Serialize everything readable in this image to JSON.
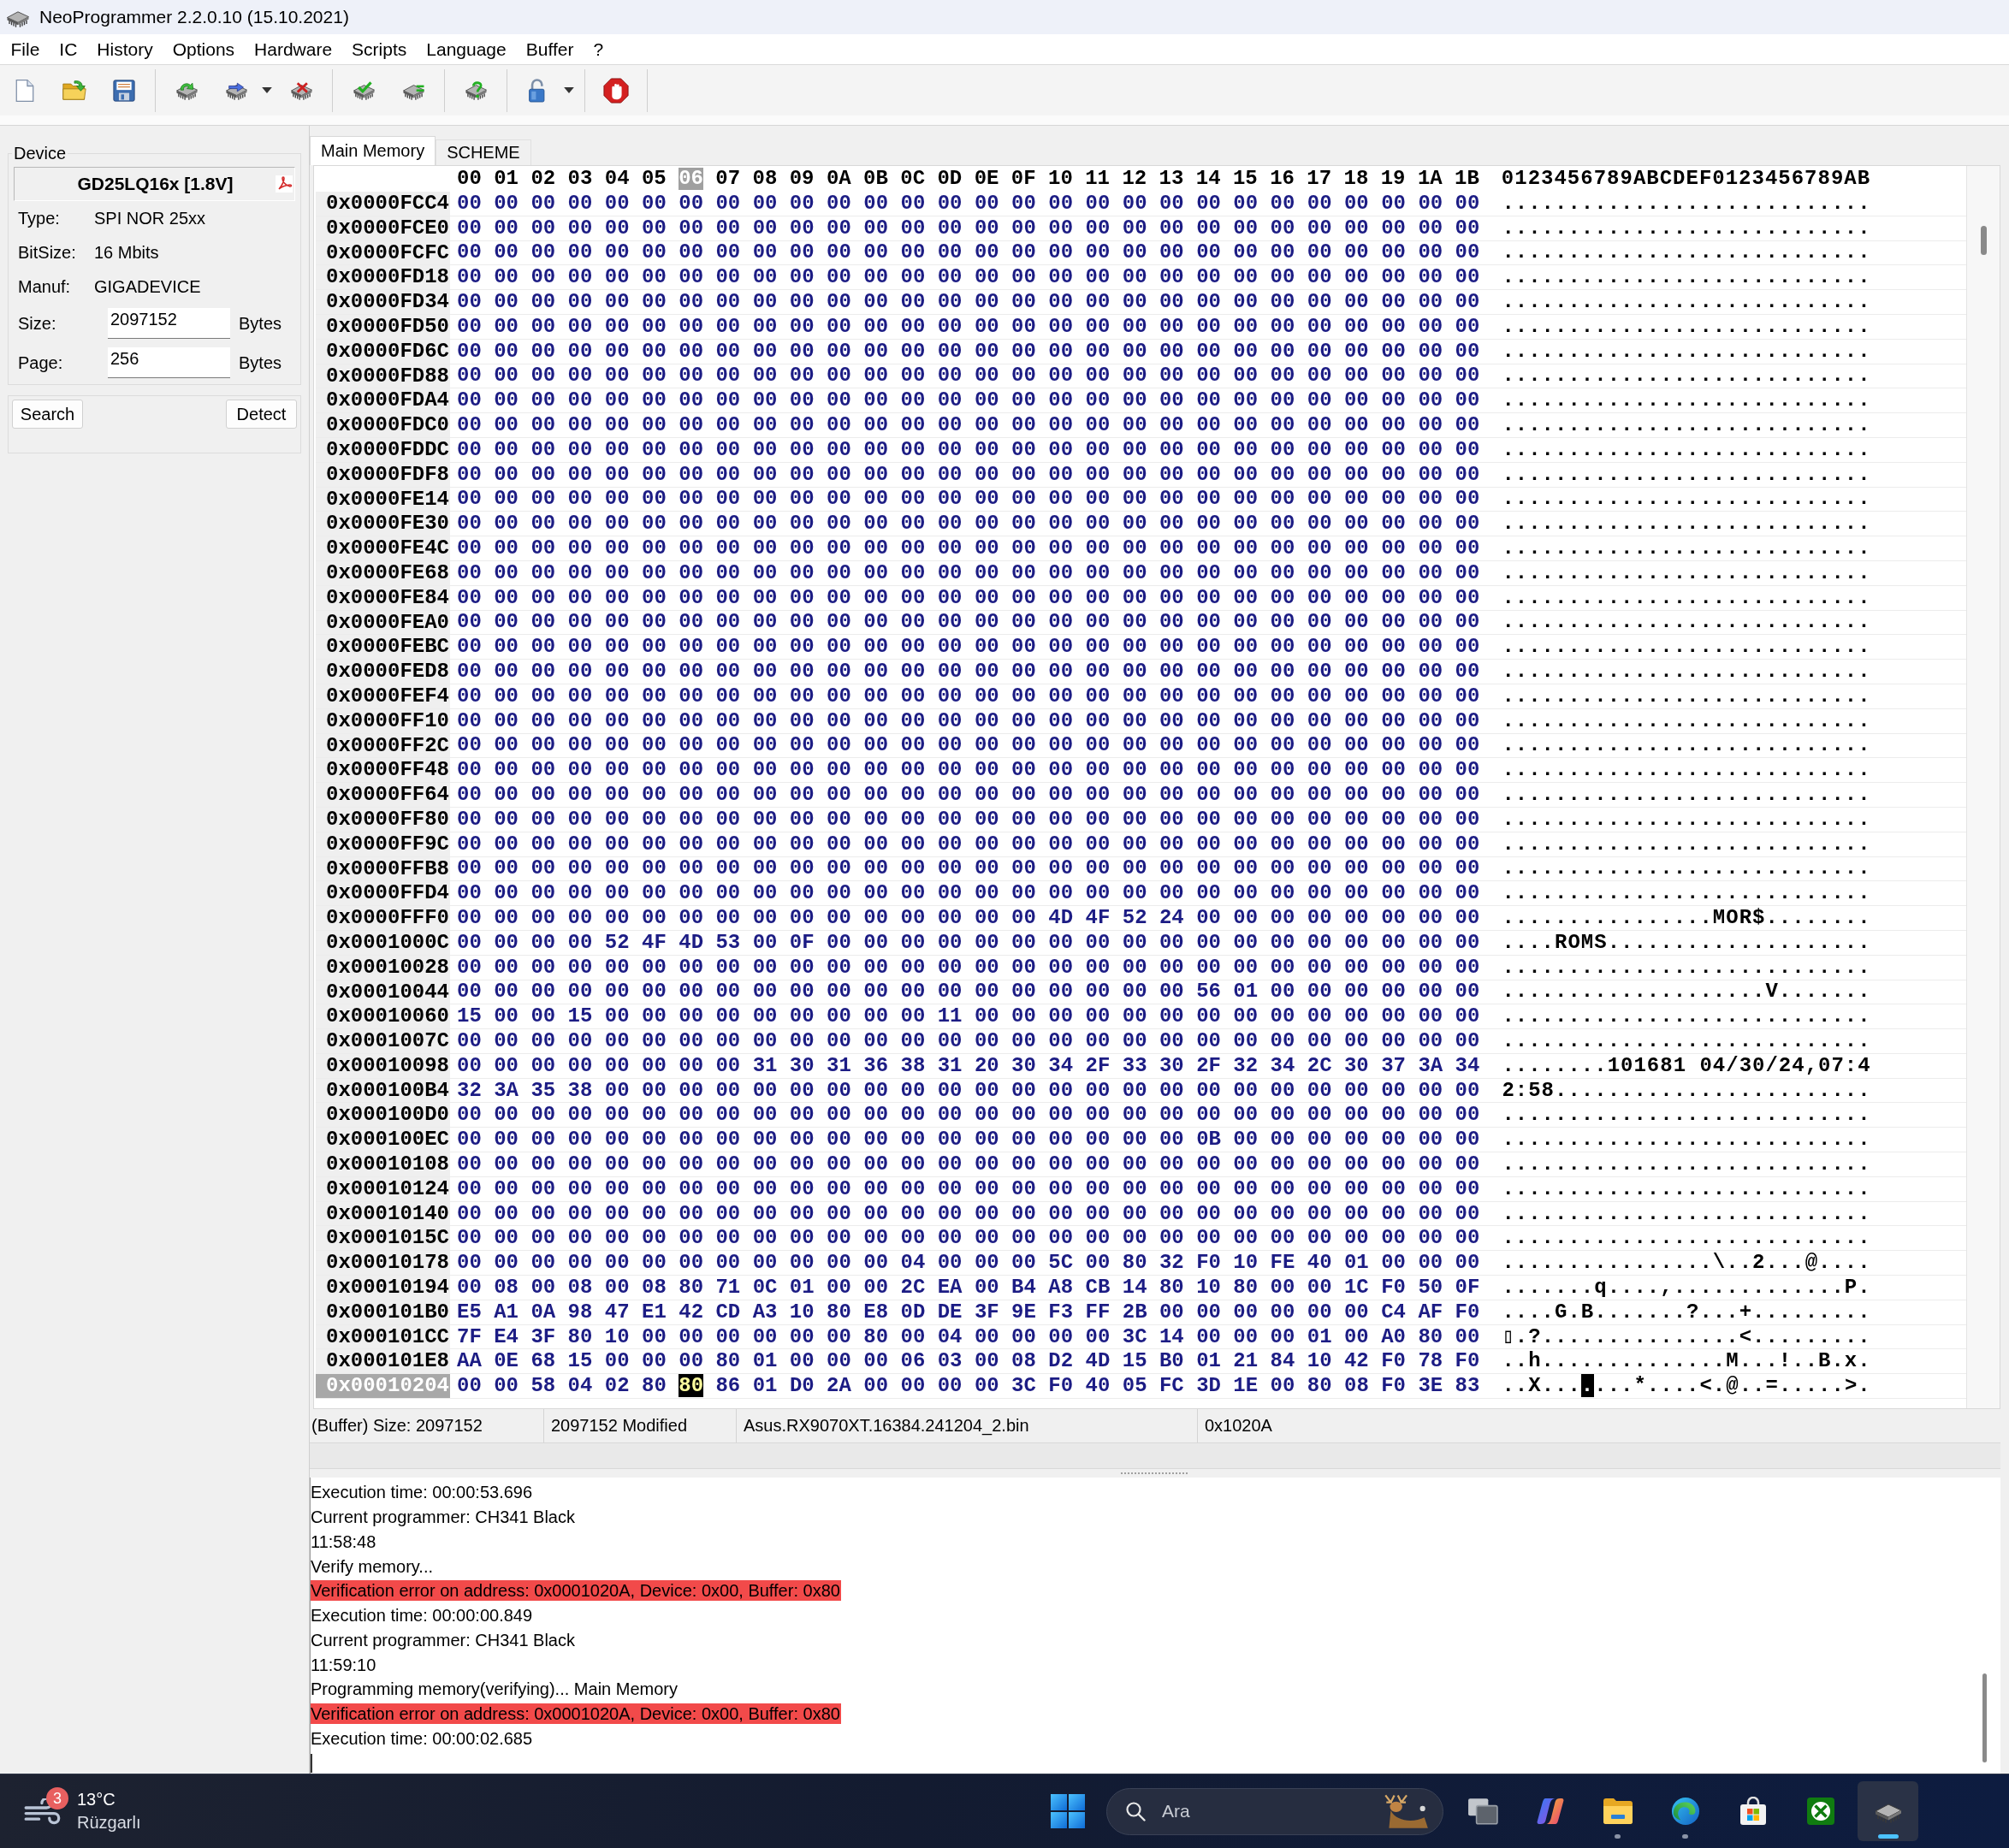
{
  "window": {
    "title": "NeoProgrammer 2.2.0.10 (15.10.2021)"
  },
  "menu": [
    "File",
    "IC",
    "History",
    "Options",
    "Hardware",
    "Scripts",
    "Language",
    "Buffer",
    "?"
  ],
  "device_panel": {
    "group_title": "Device",
    "device_name": "GD25LQ16x [1.8V]",
    "properties": [
      {
        "label": "Type:",
        "value": "SPI NOR 25xx"
      },
      {
        "label": "BitSize:",
        "value": "16 Mbits"
      },
      {
        "label": "Manuf:",
        "value": "GIGADEVICE"
      }
    ],
    "fields": [
      {
        "label": "Size:",
        "value": "2097152",
        "unit": "Bytes"
      },
      {
        "label": "Page:",
        "value": "256",
        "unit": "Bytes"
      }
    ],
    "buttons": [
      "Search",
      "Detect"
    ]
  },
  "hex_view": {
    "tabs": [
      {
        "label": "Main Memory",
        "selected": true
      },
      {
        "label": "SCHEME",
        "selected": false
      }
    ],
    "columns": [
      {
        "label": "00",
        "selected": false
      },
      {
        "label": "01",
        "selected": false
      },
      {
        "label": "02",
        "selected": false
      },
      {
        "label": "03",
        "selected": false
      },
      {
        "label": "04",
        "selected": false
      },
      {
        "label": "05",
        "selected": false
      },
      {
        "label": "06",
        "selected": true
      },
      {
        "label": "07",
        "selected": false
      },
      {
        "label": "08",
        "selected": false
      },
      {
        "label": "09",
        "selected": false
      },
      {
        "label": "0A",
        "selected": false
      },
      {
        "label": "0B",
        "selected": false
      },
      {
        "label": "0C",
        "selected": false
      },
      {
        "label": "0D",
        "selected": false
      },
      {
        "label": "0E",
        "selected": false
      },
      {
        "label": "0F",
        "selected": false
      },
      {
        "label": "10",
        "selected": false
      },
      {
        "label": "11",
        "selected": false
      },
      {
        "label": "12",
        "selected": false
      },
      {
        "label": "13",
        "selected": false
      },
      {
        "label": "14",
        "selected": false
      },
      {
        "label": "15",
        "selected": false
      },
      {
        "label": "16",
        "selected": false
      },
      {
        "label": "17",
        "selected": false
      },
      {
        "label": "18",
        "selected": false
      },
      {
        "label": "19",
        "selected": false
      },
      {
        "label": "1A",
        "selected": false
      },
      {
        "label": "1B",
        "selected": false
      }
    ],
    "ascii_header": "0123456789ABCDEF0123456789AB",
    "rows": [
      {
        "address": "0x0000FCC4",
        "bytes": "00 00 00 00 00 00 00 00 00 00 00 00 00 00 00 00 00 00 00 00 00 00 00 00 00 00 00 00",
        "ascii": "............................",
        "selected": false
      },
      {
        "address": "0x0000FCE0",
        "bytes": "00 00 00 00 00 00 00 00 00 00 00 00 00 00 00 00 00 00 00 00 00 00 00 00 00 00 00 00",
        "ascii": "............................",
        "selected": false
      },
      {
        "address": "0x0000FCFC",
        "bytes": "00 00 00 00 00 00 00 00 00 00 00 00 00 00 00 00 00 00 00 00 00 00 00 00 00 00 00 00",
        "ascii": "............................",
        "selected": false
      },
      {
        "address": "0x0000FD18",
        "bytes": "00 00 00 00 00 00 00 00 00 00 00 00 00 00 00 00 00 00 00 00 00 00 00 00 00 00 00 00",
        "ascii": "............................",
        "selected": false
      },
      {
        "address": "0x0000FD34",
        "bytes": "00 00 00 00 00 00 00 00 00 00 00 00 00 00 00 00 00 00 00 00 00 00 00 00 00 00 00 00",
        "ascii": "............................",
        "selected": false
      },
      {
        "address": "0x0000FD50",
        "bytes": "00 00 00 00 00 00 00 00 00 00 00 00 00 00 00 00 00 00 00 00 00 00 00 00 00 00 00 00",
        "ascii": "............................",
        "selected": false
      },
      {
        "address": "0x0000FD6C",
        "bytes": "00 00 00 00 00 00 00 00 00 00 00 00 00 00 00 00 00 00 00 00 00 00 00 00 00 00 00 00",
        "ascii": "............................",
        "selected": false
      },
      {
        "address": "0x0000FD88",
        "bytes": "00 00 00 00 00 00 00 00 00 00 00 00 00 00 00 00 00 00 00 00 00 00 00 00 00 00 00 00",
        "ascii": "............................",
        "selected": false
      },
      {
        "address": "0x0000FDA4",
        "bytes": "00 00 00 00 00 00 00 00 00 00 00 00 00 00 00 00 00 00 00 00 00 00 00 00 00 00 00 00",
        "ascii": "............................",
        "selected": false
      },
      {
        "address": "0x0000FDC0",
        "bytes": "00 00 00 00 00 00 00 00 00 00 00 00 00 00 00 00 00 00 00 00 00 00 00 00 00 00 00 00",
        "ascii": "............................",
        "selected": false
      },
      {
        "address": "0x0000FDDC",
        "bytes": "00 00 00 00 00 00 00 00 00 00 00 00 00 00 00 00 00 00 00 00 00 00 00 00 00 00 00 00",
        "ascii": "............................",
        "selected": false
      },
      {
        "address": "0x0000FDF8",
        "bytes": "00 00 00 00 00 00 00 00 00 00 00 00 00 00 00 00 00 00 00 00 00 00 00 00 00 00 00 00",
        "ascii": "............................",
        "selected": false
      },
      {
        "address": "0x0000FE14",
        "bytes": "00 00 00 00 00 00 00 00 00 00 00 00 00 00 00 00 00 00 00 00 00 00 00 00 00 00 00 00",
        "ascii": "............................",
        "selected": false
      },
      {
        "address": "0x0000FE30",
        "bytes": "00 00 00 00 00 00 00 00 00 00 00 00 00 00 00 00 00 00 00 00 00 00 00 00 00 00 00 00",
        "ascii": "............................",
        "selected": false
      },
      {
        "address": "0x0000FE4C",
        "bytes": "00 00 00 00 00 00 00 00 00 00 00 00 00 00 00 00 00 00 00 00 00 00 00 00 00 00 00 00",
        "ascii": "............................",
        "selected": false
      },
      {
        "address": "0x0000FE68",
        "bytes": "00 00 00 00 00 00 00 00 00 00 00 00 00 00 00 00 00 00 00 00 00 00 00 00 00 00 00 00",
        "ascii": "............................",
        "selected": false
      },
      {
        "address": "0x0000FE84",
        "bytes": "00 00 00 00 00 00 00 00 00 00 00 00 00 00 00 00 00 00 00 00 00 00 00 00 00 00 00 00",
        "ascii": "............................",
        "selected": false
      },
      {
        "address": "0x0000FEA0",
        "bytes": "00 00 00 00 00 00 00 00 00 00 00 00 00 00 00 00 00 00 00 00 00 00 00 00 00 00 00 00",
        "ascii": "............................",
        "selected": false
      },
      {
        "address": "0x0000FEBC",
        "bytes": "00 00 00 00 00 00 00 00 00 00 00 00 00 00 00 00 00 00 00 00 00 00 00 00 00 00 00 00",
        "ascii": "............................",
        "selected": false
      },
      {
        "address": "0x0000FED8",
        "bytes": "00 00 00 00 00 00 00 00 00 00 00 00 00 00 00 00 00 00 00 00 00 00 00 00 00 00 00 00",
        "ascii": "............................",
        "selected": false
      },
      {
        "address": "0x0000FEF4",
        "bytes": "00 00 00 00 00 00 00 00 00 00 00 00 00 00 00 00 00 00 00 00 00 00 00 00 00 00 00 00",
        "ascii": "............................",
        "selected": false
      },
      {
        "address": "0x0000FF10",
        "bytes": "00 00 00 00 00 00 00 00 00 00 00 00 00 00 00 00 00 00 00 00 00 00 00 00 00 00 00 00",
        "ascii": "............................",
        "selected": false
      },
      {
        "address": "0x0000FF2C",
        "bytes": "00 00 00 00 00 00 00 00 00 00 00 00 00 00 00 00 00 00 00 00 00 00 00 00 00 00 00 00",
        "ascii": "............................",
        "selected": false
      },
      {
        "address": "0x0000FF48",
        "bytes": "00 00 00 00 00 00 00 00 00 00 00 00 00 00 00 00 00 00 00 00 00 00 00 00 00 00 00 00",
        "ascii": "............................",
        "selected": false
      },
      {
        "address": "0x0000FF64",
        "bytes": "00 00 00 00 00 00 00 00 00 00 00 00 00 00 00 00 00 00 00 00 00 00 00 00 00 00 00 00",
        "ascii": "............................",
        "selected": false
      },
      {
        "address": "0x0000FF80",
        "bytes": "00 00 00 00 00 00 00 00 00 00 00 00 00 00 00 00 00 00 00 00 00 00 00 00 00 00 00 00",
        "ascii": "............................",
        "selected": false
      },
      {
        "address": "0x0000FF9C",
        "bytes": "00 00 00 00 00 00 00 00 00 00 00 00 00 00 00 00 00 00 00 00 00 00 00 00 00 00 00 00",
        "ascii": "............................",
        "selected": false
      },
      {
        "address": "0x0000FFB8",
        "bytes": "00 00 00 00 00 00 00 00 00 00 00 00 00 00 00 00 00 00 00 00 00 00 00 00 00 00 00 00",
        "ascii": "............................",
        "selected": false
      },
      {
        "address": "0x0000FFD4",
        "bytes": "00 00 00 00 00 00 00 00 00 00 00 00 00 00 00 00 00 00 00 00 00 00 00 00 00 00 00 00",
        "ascii": "............................",
        "selected": false
      },
      {
        "address": "0x0000FFF0",
        "bytes": "00 00 00 00 00 00 00 00 00 00 00 00 00 00 00 00 4D 4F 52 24 00 00 00 00 00 00 00 00",
        "ascii": "................MOR$........",
        "selected": false
      },
      {
        "address": "0x0001000C",
        "bytes": "00 00 00 00 52 4F 4D 53 00 0F 00 00 00 00 00 00 00 00 00 00 00 00 00 00 00 00 00 00",
        "ascii": "....ROMS....................",
        "selected": false
      },
      {
        "address": "0x00010028",
        "bytes": "00 00 00 00 00 00 00 00 00 00 00 00 00 00 00 00 00 00 00 00 00 00 00 00 00 00 00 00",
        "ascii": "............................",
        "selected": false
      },
      {
        "address": "0x00010044",
        "bytes": "00 00 00 00 00 00 00 00 00 00 00 00 00 00 00 00 00 00 00 00 56 01 00 00 00 00 00 00",
        "ascii": "....................V.......",
        "selected": false
      },
      {
        "address": "0x00010060",
        "bytes": "15 00 00 15 00 00 00 00 00 00 00 00 00 11 00 00 00 00 00 00 00 00 00 00 00 00 00 00",
        "ascii": "............................",
        "selected": false
      },
      {
        "address": "0x0001007C",
        "bytes": "00 00 00 00 00 00 00 00 00 00 00 00 00 00 00 00 00 00 00 00 00 00 00 00 00 00 00 00",
        "ascii": "............................",
        "selected": false
      },
      {
        "address": "0x00010098",
        "bytes": "00 00 00 00 00 00 00 00 31 30 31 36 38 31 20 30 34 2F 33 30 2F 32 34 2C 30 37 3A 34",
        "ascii": "........101681 04/30/24,07:4",
        "selected": false
      },
      {
        "address": "0x000100B4",
        "bytes": "32 3A 35 38 00 00 00 00 00 00 00 00 00 00 00 00 00 00 00 00 00 00 00 00 00 00 00 00",
        "ascii": "2:58........................",
        "selected": false
      },
      {
        "address": "0x000100D0",
        "bytes": "00 00 00 00 00 00 00 00 00 00 00 00 00 00 00 00 00 00 00 00 00 00 00 00 00 00 00 00",
        "ascii": "............................",
        "selected": false
      },
      {
        "address": "0x000100EC",
        "bytes": "00 00 00 00 00 00 00 00 00 00 00 00 00 00 00 00 00 00 00 00 0B 00 00 00 00 00 00 00",
        "ascii": "............................",
        "selected": false
      },
      {
        "address": "0x00010108",
        "bytes": "00 00 00 00 00 00 00 00 00 00 00 00 00 00 00 00 00 00 00 00 00 00 00 00 00 00 00 00",
        "ascii": "............................",
        "selected": false
      },
      {
        "address": "0x00010124",
        "bytes": "00 00 00 00 00 00 00 00 00 00 00 00 00 00 00 00 00 00 00 00 00 00 00 00 00 00 00 00",
        "ascii": "............................",
        "selected": false
      },
      {
        "address": "0x00010140",
        "bytes": "00 00 00 00 00 00 00 00 00 00 00 00 00 00 00 00 00 00 00 00 00 00 00 00 00 00 00 00",
        "ascii": "............................",
        "selected": false
      },
      {
        "address": "0x0001015C",
        "bytes": "00 00 00 00 00 00 00 00 00 00 00 00 00 00 00 00 00 00 00 00 00 00 00 00 00 00 00 00",
        "ascii": "............................",
        "selected": false
      },
      {
        "address": "0x00010178",
        "bytes": "00 00 00 00 00 00 00 00 00 00 00 00 04 00 00 00 5C 00 80 32 F0 10 FE 40 01 00 00 00",
        "ascii": "................\\..2...@....",
        "selected": false
      },
      {
        "address": "0x00010194",
        "bytes": "00 08 00 08 00 08 80 71 0C 01 00 00 2C EA 00 B4 A8 CB 14 80 10 80 00 00 1C F0 50 0F",
        "ascii": ".......q....,.............P.",
        "selected": false
      },
      {
        "address": "0x000101B0",
        "bytes": "E5 A1 0A 98 47 E1 42 CD A3 10 80 E8 0D DE 3F 9E F3 FF 2B 00 00 00 00 00 00 C4 AF F0",
        "ascii": "....G.B.......?...+.........",
        "selected": false
      },
      {
        "address": "0x000101CC",
        "bytes": "7F E4 3F 80 10 00 00 00 00 00 00 80 00 04 00 00 00 00 3C 14 00 00 00 01 00 A0 80 00",
        "ascii": "▯.?...............<.........",
        "selected": false
      },
      {
        "address": "0x000101E8",
        "bytes": "AA 0E 68 15 00 00 00 80 01 00 00 00 06 03 00 08 D2 4D 15 B0 01 21 84 10 42 F0 78 F0",
        "ascii": "..h..............M...!..B.x.",
        "selected": false
      },
      {
        "address": "0x00010204",
        "bytes": "00 00 58 04 02 80 80 86 01 D0 2A 00 00 00 00 3C F0 40 05 FC 3D 1E 00 80 08 F0 3E 83",
        "ascii": "..X.......*....<.@..=.....>.",
        "selected": true
      }
    ]
  },
  "status_bar": [
    "(Buffer) Size: 2097152",
    "2097152 Modified",
    "Asus.RX9070XT.16384.241204_2.bin",
    "0x1020A"
  ],
  "log": [
    {
      "text": "Execution time: 00:00:53.696",
      "error": false
    },
    {
      "text": "Current programmer: CH341 Black",
      "error": false
    },
    {
      "text": "11:58:48",
      "error": false
    },
    {
      "text": "Verify memory...",
      "error": false
    },
    {
      "text": "Verification error on address: 0x0001020A, Device: 0x00, Buffer: 0x80",
      "error": true
    },
    {
      "text": "Execution time: 00:00:00.849",
      "error": false
    },
    {
      "text": "Current programmer: CH341 Black",
      "error": false
    },
    {
      "text": "11:59:10",
      "error": false
    },
    {
      "text": "Programming memory(verifying)... Main Memory",
      "error": false
    },
    {
      "text": "Verification error on address: 0x0001020A, Device: 0x00, Buffer: 0x80",
      "error": true
    },
    {
      "text": "Execution time: 00:00:02.685",
      "error": false
    }
  ],
  "taskbar": {
    "weather": {
      "badge": "3",
      "temperature": "13°C",
      "condition": "Rüzgarlı"
    },
    "search": {
      "placeholder": "Ara"
    },
    "apps": [
      {
        "kind": "task-view",
        "running": false,
        "selected": false
      },
      {
        "kind": "assistant",
        "running": false,
        "selected": false
      },
      {
        "kind": "files",
        "running": true,
        "selected": false
      },
      {
        "kind": "browser",
        "running": true,
        "selected": false
      },
      {
        "kind": "store",
        "running": false,
        "selected": false
      },
      {
        "kind": "games",
        "running": false,
        "selected": false
      },
      {
        "kind": "chip",
        "running": true,
        "selected": true
      }
    ]
  }
}
